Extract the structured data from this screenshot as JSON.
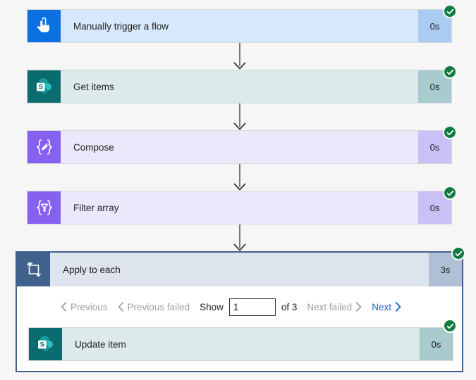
{
  "colors": {
    "page_background": "#f6f6f6",
    "trigger_blue": "#0b70e1",
    "sharepoint_teal": "#0b6c70",
    "data_purple": "#8661ef",
    "loop_blue": "#40618c",
    "success_green": "#107c41",
    "link_blue": "#1567d3",
    "disabled_gray": "#a19f9d"
  },
  "flow": {
    "steps": [
      {
        "id": "manually-trigger-a-flow",
        "title": "Manually trigger a flow",
        "duration": "0s",
        "status": "succeeded",
        "icon": "touch-hand-icon",
        "variant": "trigger"
      },
      {
        "id": "get-items",
        "title": "Get items",
        "duration": "0s",
        "status": "succeeded",
        "icon": "sharepoint-icon",
        "variant": "sharepoint"
      },
      {
        "id": "compose",
        "title": "Compose",
        "duration": "0s",
        "status": "succeeded",
        "icon": "compose-braces-pencil-icon",
        "variant": "data"
      },
      {
        "id": "filter-array",
        "title": "Filter array",
        "duration": "0s",
        "status": "succeeded",
        "icon": "filter-funnel-braces-icon",
        "variant": "data"
      }
    ],
    "scope": {
      "id": "apply-to-each",
      "title": "Apply to each",
      "duration": "3s",
      "status": "succeeded",
      "icon": "loop-repeat-icon",
      "pager": {
        "previous_label": "Previous",
        "previous_failed_label": "Previous failed",
        "show_label": "Show",
        "page_value": "1",
        "page_placeholder": "",
        "of_label": "of 3",
        "next_failed_label": "Next failed",
        "next_label": "Next",
        "previous_enabled": false,
        "previous_failed_enabled": false,
        "next_failed_enabled": false,
        "next_enabled": true
      },
      "children": [
        {
          "id": "update-item",
          "title": "Update item",
          "duration": "0s",
          "status": "succeeded",
          "icon": "sharepoint-icon",
          "variant": "sharepoint"
        }
      ]
    }
  }
}
